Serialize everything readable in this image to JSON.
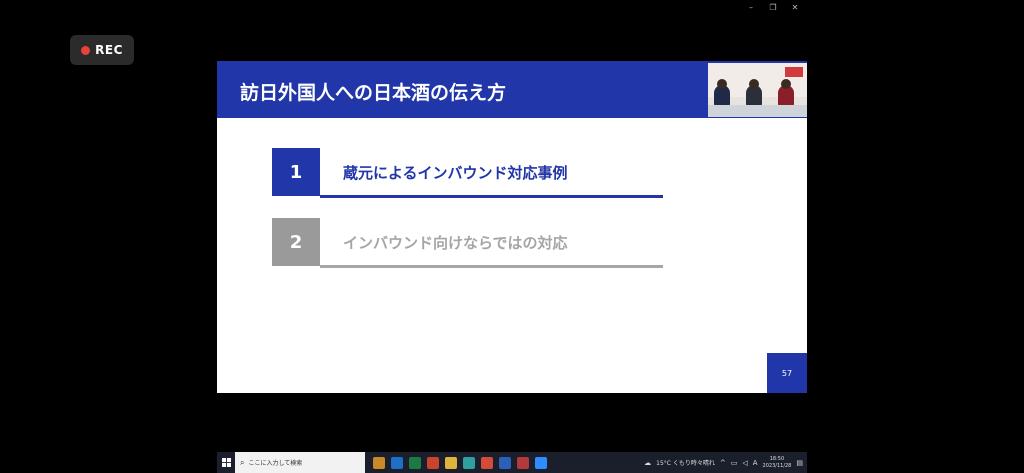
{
  "window": {
    "minimize_glyph": "–",
    "restore_glyph": "❐",
    "close_glyph": "✕"
  },
  "recording": {
    "label": "REC",
    "dot_color": "#e5443a"
  },
  "slide": {
    "title": "訪日外国人への日本酒の伝え方",
    "accent_color": "#2136a8",
    "items": [
      {
        "number": "1",
        "label": "蔵元によるインバウンド対応事例",
        "state": "active"
      },
      {
        "number": "2",
        "label": "インバウンド向けならではの対応",
        "state": "inactive"
      }
    ],
    "page_number": "57"
  },
  "taskbar": {
    "search_placeholder": "ここに入力して検索",
    "apps": [
      {
        "icon": "briefcase-icon",
        "color": "#c9892a"
      },
      {
        "icon": "outlook-icon",
        "color": "#1e6fc7"
      },
      {
        "icon": "excel-icon",
        "color": "#1d7a45"
      },
      {
        "icon": "powerpoint-icon",
        "color": "#c9442a"
      },
      {
        "icon": "folder-icon",
        "color": "#e0b43a"
      },
      {
        "icon": "edge-icon",
        "color": "#2ea0a0"
      },
      {
        "icon": "chrome-icon",
        "color": "#d44b3a"
      },
      {
        "icon": "word-icon",
        "color": "#2b5fb8"
      },
      {
        "icon": "media-player-icon",
        "color": "#b23a3a"
      },
      {
        "icon": "zoom-icon",
        "color": "#2d8cff"
      }
    ],
    "weather": "15°C くもり時々晴れ",
    "ime": "A",
    "clock_time": "18:50",
    "clock_date": "2023/11/28"
  }
}
